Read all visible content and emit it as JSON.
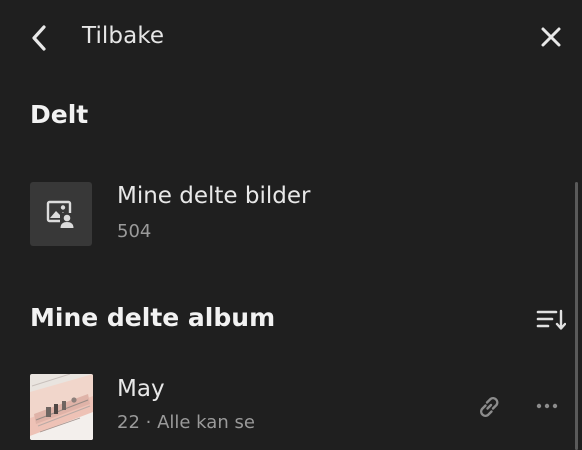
{
  "header": {
    "back_label": "Tilbake"
  },
  "shared_section": {
    "title": "Delt",
    "item": {
      "title": "Mine delte bilder",
      "count": "504"
    }
  },
  "albums_section": {
    "title": "Mine delte album",
    "albums": [
      {
        "title": "May",
        "subtitle": "22 · Alle kan se"
      }
    ]
  },
  "icons": {
    "back": "chevron-left-icon",
    "close": "close-icon",
    "shared_thumb": "shared-photos-icon",
    "sort": "sort-icon",
    "link": "link-icon",
    "more": "more-icon"
  }
}
